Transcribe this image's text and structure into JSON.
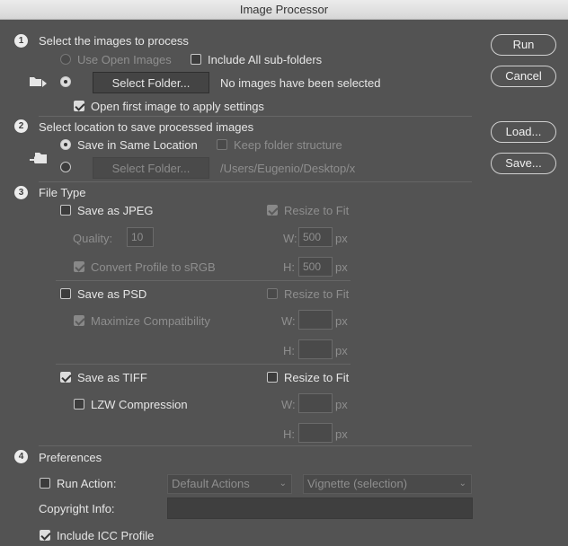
{
  "window": {
    "title": "Image Processor"
  },
  "section1": {
    "number": "1",
    "title": "Select the images to process",
    "use_open_images": "Use Open Images",
    "include_subfolders": "Include All sub-folders",
    "select_folder": "Select Folder...",
    "status": "No images have been selected",
    "open_first": "Open first image to apply settings"
  },
  "section2": {
    "number": "2",
    "title": "Select location to save processed images",
    "save_same": "Save in Same Location",
    "keep_structure": "Keep folder structure",
    "select_folder": "Select Folder...",
    "path": "/Users/Eugenio/Desktop/x"
  },
  "section3": {
    "number": "3",
    "title": "File Type",
    "jpeg": {
      "label": "Save as JPEG",
      "resize": "Resize to Fit",
      "quality_label": "Quality:",
      "quality_value": "10",
      "w_label": "W:",
      "w_value": "500",
      "w_unit": "px",
      "h_label": "H:",
      "h_value": "500",
      "h_unit": "px",
      "convert": "Convert Profile to sRGB"
    },
    "psd": {
      "label": "Save as PSD",
      "resize": "Resize to Fit",
      "maximize": "Maximize Compatibility",
      "w_label": "W:",
      "w_unit": "px",
      "h_label": "H:",
      "h_unit": "px"
    },
    "tiff": {
      "label": "Save as TIFF",
      "resize": "Resize to Fit",
      "lzw": "LZW Compression",
      "w_label": "W:",
      "w_unit": "px",
      "h_label": "H:",
      "h_unit": "px"
    }
  },
  "section4": {
    "number": "4",
    "title": "Preferences",
    "run_action": "Run Action:",
    "action_set": "Default Actions",
    "action": "Vignette (selection)",
    "copyright": "Copyright Info:",
    "icc": "Include ICC Profile"
  },
  "buttons": {
    "run": "Run",
    "cancel": "Cancel",
    "load": "Load...",
    "save": "Save..."
  }
}
